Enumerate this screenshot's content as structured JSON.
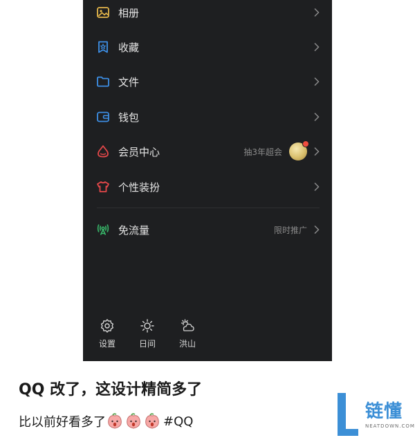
{
  "menu": {
    "items": [
      {
        "label": "相册",
        "icon": "photo-icon",
        "color": "#e7b84b"
      },
      {
        "label": "收藏",
        "icon": "favorite-icon",
        "color": "#3d8fe6"
      },
      {
        "label": "文件",
        "icon": "folder-icon",
        "color": "#3d8fe6"
      },
      {
        "label": "钱包",
        "icon": "wallet-icon",
        "color": "#3d8fe6"
      },
      {
        "label": "会员中心",
        "icon": "vip-icon",
        "color": "#e6484a",
        "hint": "抽3年超会"
      },
      {
        "label": "个性装扮",
        "icon": "shirt-icon",
        "color": "#e6484a"
      },
      {
        "label": "免流量",
        "icon": "signal-icon",
        "color": "#38b86a",
        "hint": "限时推广"
      }
    ]
  },
  "bottom": {
    "settings": "设置",
    "theme": "日间",
    "weather": "洪山"
  },
  "caption": {
    "title": "QQ 改了，这设计精简多了",
    "body": "比以前好看多了",
    "tag": "#QQ"
  },
  "watermark": {
    "name": "链懂",
    "site": "NEATDOWN.COM"
  }
}
